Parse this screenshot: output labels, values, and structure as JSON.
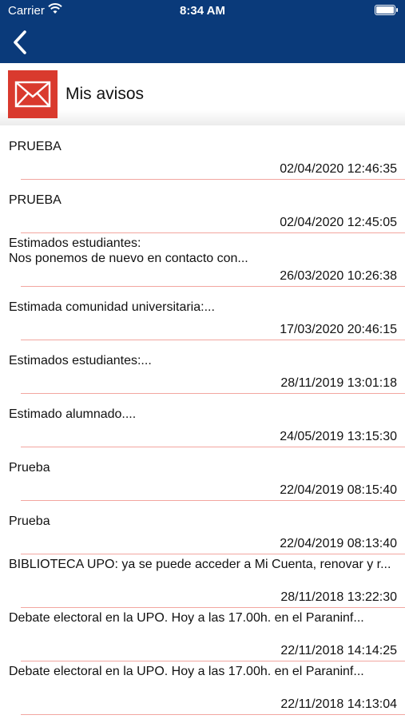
{
  "status_bar": {
    "carrier": "Carrier",
    "time": "8:34 AM"
  },
  "nav": {
    "back_icon": "chevron-left-icon"
  },
  "header": {
    "title": "Mis avisos",
    "icon": "envelope-icon",
    "accent": "#d93a2e"
  },
  "colors": {
    "navbar": "#0a3a7a",
    "separator": "#f2a6a0"
  },
  "notices": [
    {
      "text": "PRUEBA",
      "date": "02/04/2020 12:46:35"
    },
    {
      "text": "PRUEBA",
      "date": "02/04/2020 12:45:05"
    },
    {
      "text": "Estimados estudiantes:\nNos ponemos de nuevo en contacto con...",
      "date": "26/03/2020 10:26:38"
    },
    {
      "text": "Estimada comunidad universitaria:...",
      "date": "17/03/2020 20:46:15"
    },
    {
      "text": "Estimados estudiantes:...",
      "date": "28/11/2019 13:01:18"
    },
    {
      "text": "Estimado alumnado....",
      "date": "24/05/2019 13:15:30"
    },
    {
      "text": "Prueba",
      "date": "22/04/2019 08:15:40"
    },
    {
      "text": "Prueba",
      "date": "22/04/2019 08:13:40"
    },
    {
      "text": "BIBLIOTECA UPO: ya se puede acceder a Mi Cuenta, renovar y r...",
      "date": "28/11/2018 13:22:30"
    },
    {
      "text": "Debate electoral en la UPO. Hoy a las 17.00h. en el Paraninf...",
      "date": "22/11/2018 14:14:25"
    },
    {
      "text": "Debate electoral en la UPO. Hoy a las 17.00h. en el Paraninf...",
      "date": "22/11/2018 14:13:04"
    }
  ]
}
